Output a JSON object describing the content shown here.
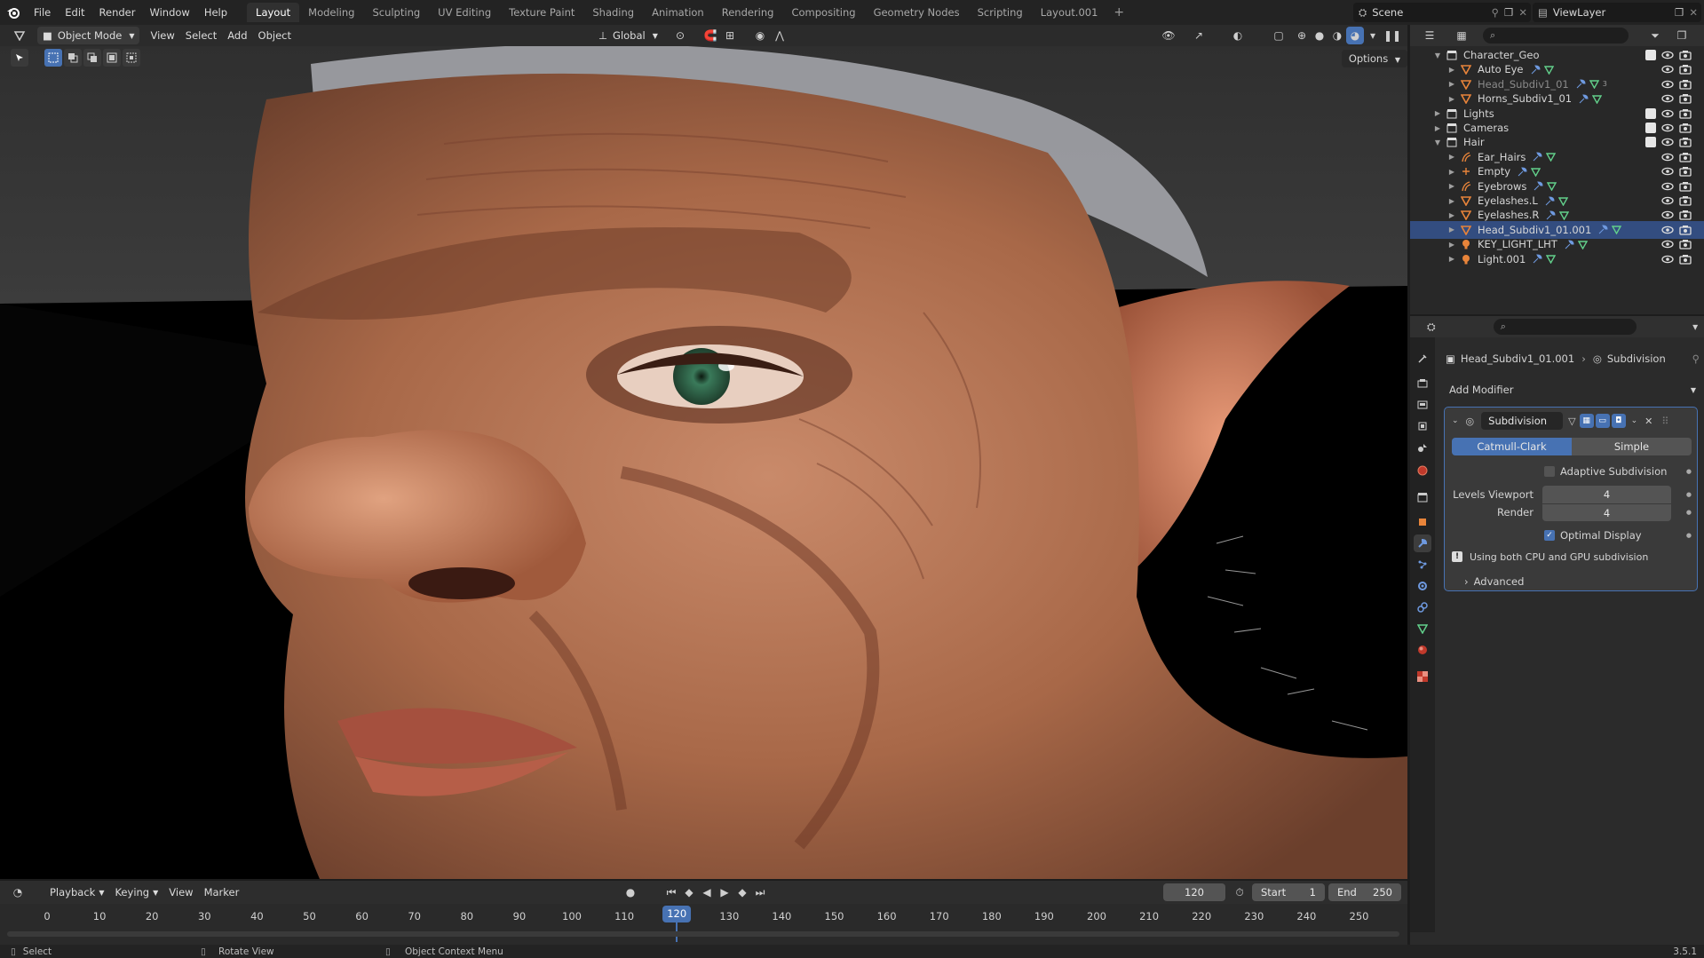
{
  "topbar": {
    "menus": [
      "File",
      "Edit",
      "Render",
      "Window",
      "Help"
    ],
    "workspaces": [
      "Layout",
      "Modeling",
      "Sculpting",
      "UV Editing",
      "Texture Paint",
      "Shading",
      "Animation",
      "Rendering",
      "Compositing",
      "Geometry Nodes",
      "Scripting",
      "Layout.001"
    ],
    "active_workspace": "Layout",
    "scene": "Scene",
    "view_layer": "ViewLayer"
  },
  "viewport_header": {
    "mode": "Object Mode",
    "menus": [
      "View",
      "Select",
      "Add",
      "Object"
    ],
    "orientation": "Global",
    "options": "Options"
  },
  "outliner": {
    "rows": [
      {
        "label": "Character_Geo",
        "type": "collection",
        "indent": 1,
        "expanded": true
      },
      {
        "label": "Auto Eye",
        "type": "mesh",
        "indent": 2
      },
      {
        "label": "Head_Subdiv1_01",
        "type": "mesh",
        "indent": 2,
        "dim": true,
        "badge": "3"
      },
      {
        "label": "Horns_Subdiv1_01",
        "type": "mesh",
        "indent": 2
      },
      {
        "label": "Lights",
        "type": "collection",
        "indent": 1
      },
      {
        "label": "Cameras",
        "type": "collection",
        "indent": 1
      },
      {
        "label": "Hair",
        "type": "collection",
        "indent": 1,
        "expanded": true
      },
      {
        "label": "Ear_Hairs",
        "type": "curves",
        "indent": 2
      },
      {
        "label": "Empty",
        "type": "empty",
        "indent": 2
      },
      {
        "label": "Eyebrows",
        "type": "curves",
        "indent": 2
      },
      {
        "label": "Eyelashes.L",
        "type": "mesh",
        "indent": 2
      },
      {
        "label": "Eyelashes.R",
        "type": "mesh",
        "indent": 2
      },
      {
        "label": "Head_Subdiv1_01.001",
        "type": "mesh",
        "indent": 2,
        "selected": true
      },
      {
        "label": "KEY_LIGHT_LHT",
        "type": "light",
        "indent": 2
      },
      {
        "label": "Light.001",
        "type": "light",
        "indent": 2
      }
    ]
  },
  "properties": {
    "breadcrumb_object": "Head_Subdiv1_01.001",
    "breadcrumb_modifier": "Subdivision",
    "add_modifier": "Add Modifier",
    "modifier": {
      "name": "Subdivision",
      "type_options": [
        "Catmull-Clark",
        "Simple"
      ],
      "selected_type": "Catmull-Clark",
      "adaptive_label": "Adaptive Subdivision",
      "adaptive": false,
      "levels_viewport_label": "Levels Viewport",
      "levels_viewport": "4",
      "render_label": "Render",
      "render": "4",
      "optimal_label": "Optimal Display",
      "optimal": true,
      "info": "Using both CPU and GPU subdivision",
      "advanced": "Advanced"
    }
  },
  "timeline": {
    "menus": [
      "Playback",
      "Keying",
      "View",
      "Marker"
    ],
    "current_frame": "120",
    "start_label": "Start",
    "start": "1",
    "end_label": "End",
    "end": "250",
    "ticks": [
      "0",
      "10",
      "20",
      "30",
      "40",
      "50",
      "60",
      "70",
      "80",
      "90",
      "100",
      "110",
      "120",
      "130",
      "140",
      "150",
      "160",
      "170",
      "180",
      "190",
      "200",
      "210",
      "220",
      "230",
      "240",
      "250"
    ]
  },
  "status": {
    "left": "Select",
    "middle": "Rotate View",
    "right": "Object Context Menu",
    "version": "3.5.1"
  },
  "colors": {
    "accent": "#4772b3",
    "selected_row": "#334d80",
    "mesh_icon": "#e8843a",
    "modifier_icon": "#6f9ae0",
    "data_icon": "#62d08b"
  }
}
